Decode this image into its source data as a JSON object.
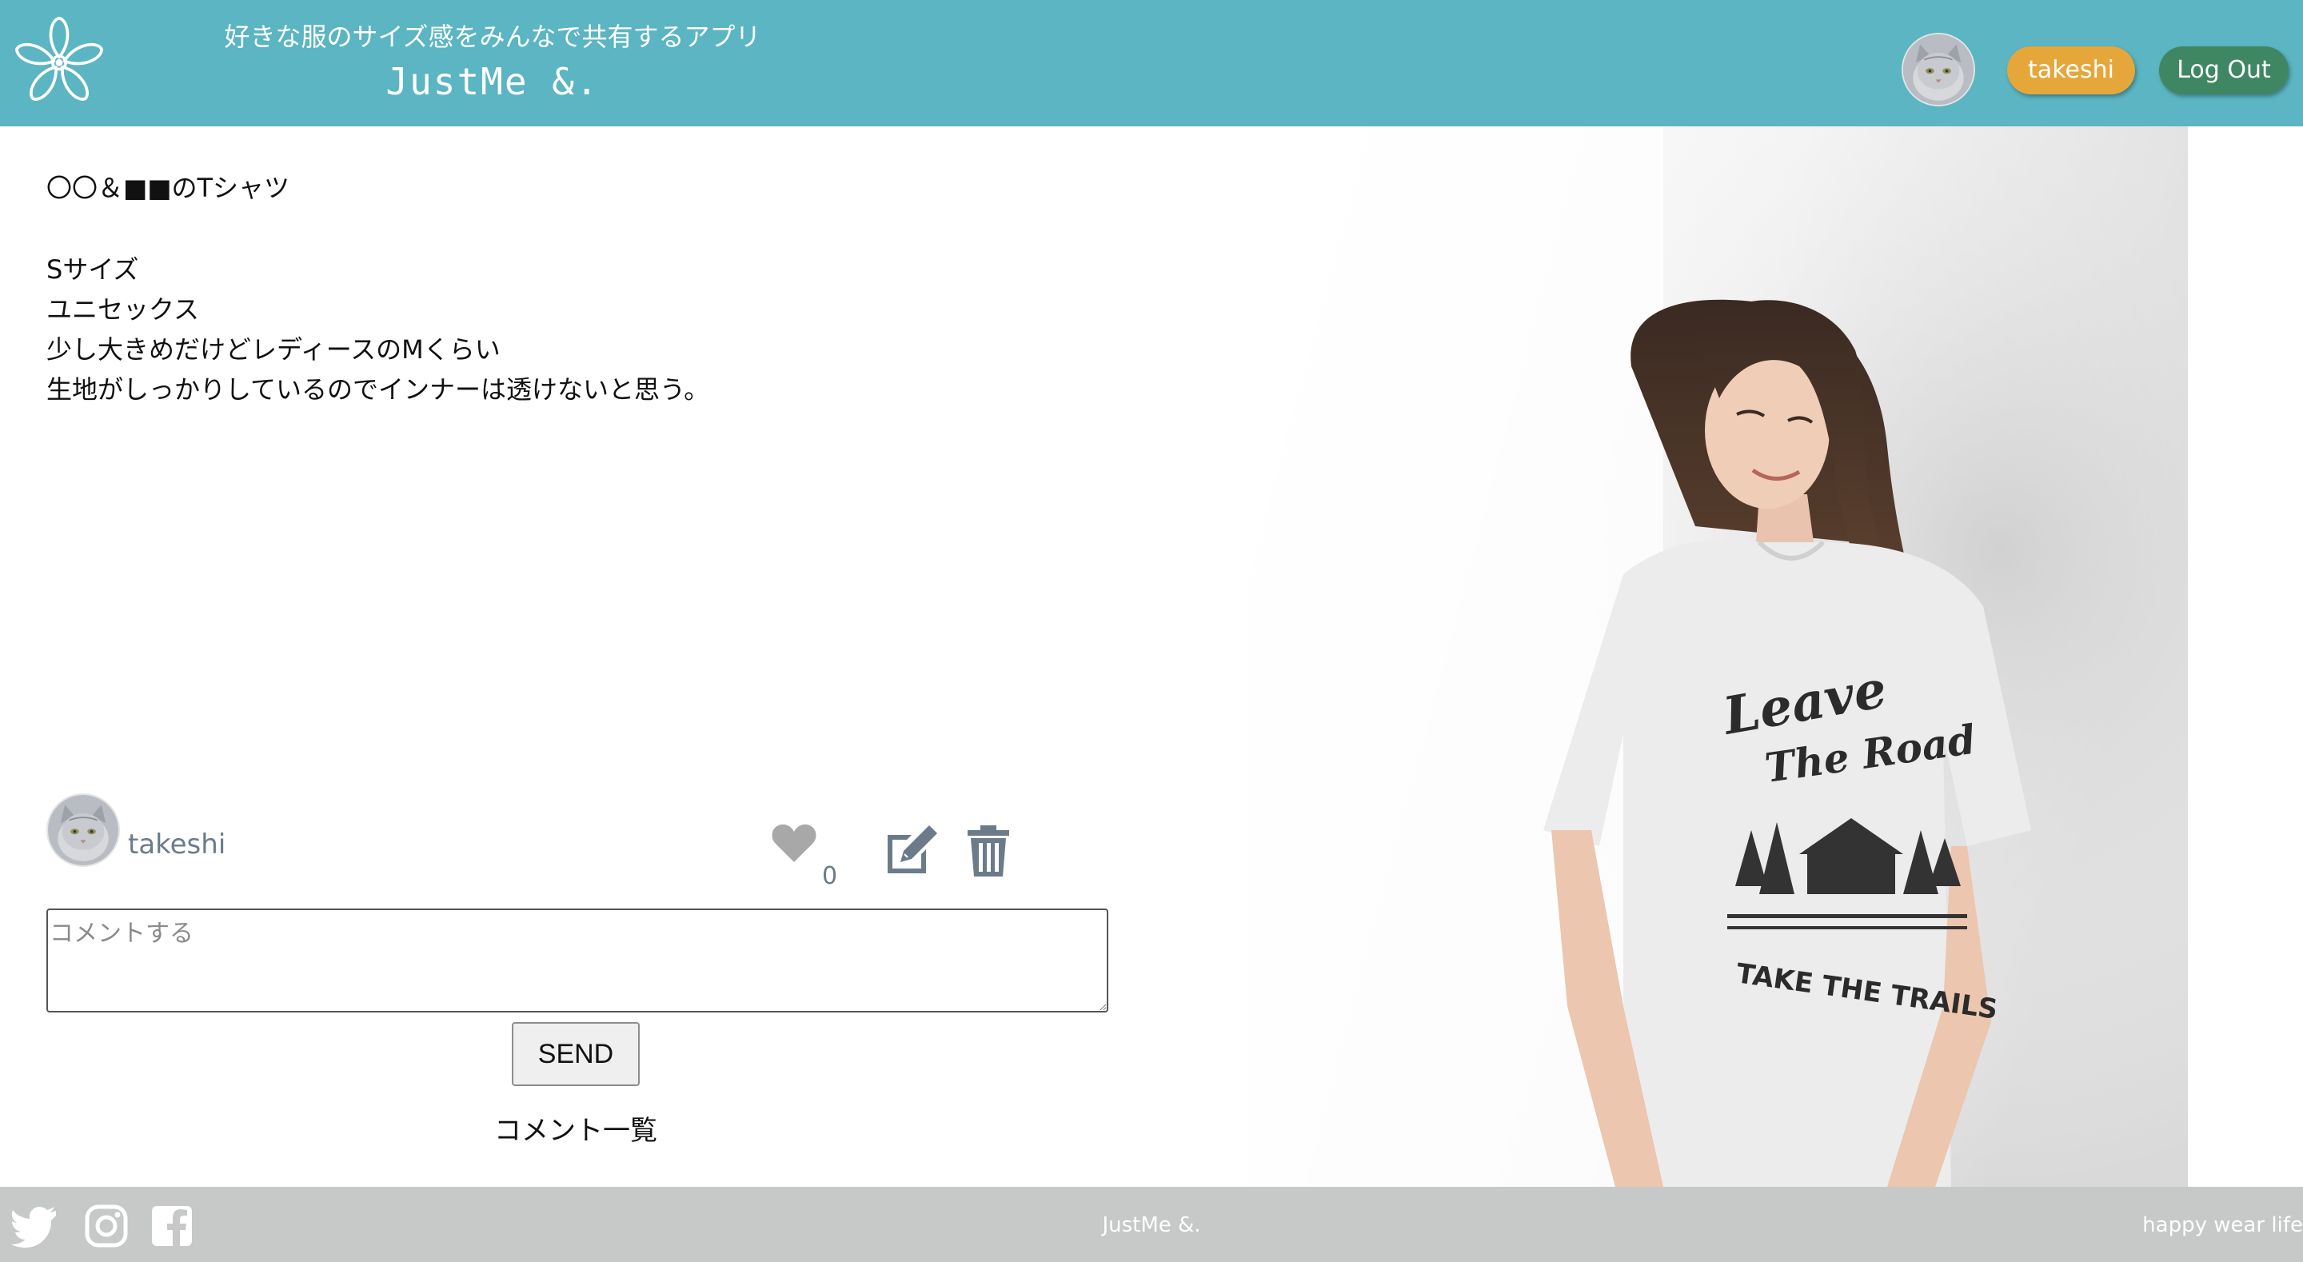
{
  "header": {
    "tagline": "好きな服のサイズ感をみんなで共有するアプリ",
    "brand": "JustMe &.",
    "user_label": "takeshi",
    "logout_label": "Log Out"
  },
  "post": {
    "title": "〇〇＆■■のTシャツ",
    "lines": [
      "Sサイズ",
      "ユニセックス",
      "少し大きめだけどレディースのMくらい",
      "生地がしっかりしているのでインナーは透けないと思う。"
    ],
    "author": "takeshi",
    "like_count": "0"
  },
  "hero_tshirt": {
    "print_line1": "Leave",
    "print_line2": "The Road",
    "print_line3": "TAKE THE TRAILS"
  },
  "comment": {
    "placeholder": "コメントする",
    "send_label": "SEND",
    "list_title": "コメント一覧"
  },
  "footer": {
    "brand": "JustMe &.",
    "slogan": "happy wear life",
    "social_icons": [
      "twitter-icon",
      "instagram-icon",
      "facebook-icon"
    ]
  },
  "colors": {
    "header_bg": "#5bb5c2",
    "user_pill": "#e6a73a",
    "logout_pill": "#3f8762",
    "footer_bg": "#c7c9c8",
    "icon_gray": "#6c7b8a",
    "heart_gray": "#a8a8a8"
  }
}
